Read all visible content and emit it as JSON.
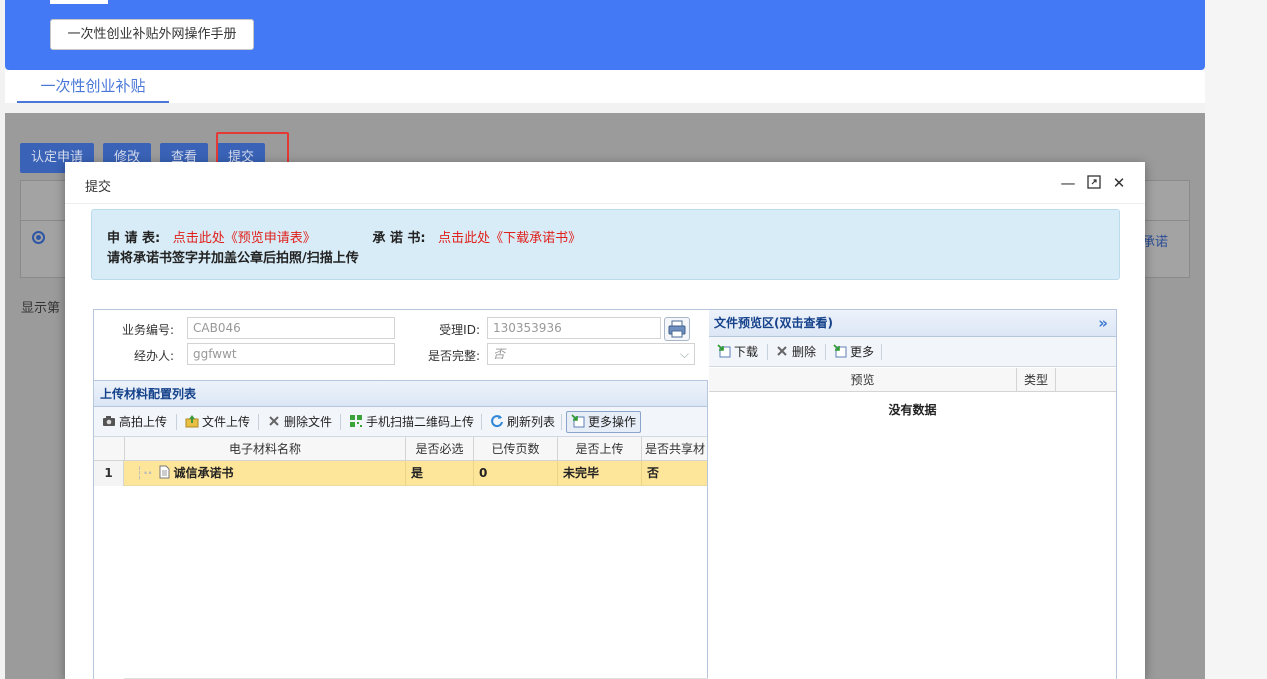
{
  "banner": {
    "manual_button": "一次性创业补贴外网操作手册"
  },
  "tabs": {
    "active": "一次性创业补贴"
  },
  "background": {
    "buttons": [
      "认定申请",
      "修改",
      "查看",
      "提交"
    ],
    "row_text_right": "承诺",
    "footer_text_left": "显示第"
  },
  "dialog": {
    "title": "提交",
    "controls": {
      "minimize": "—",
      "maximize": "⤢",
      "close": "✕"
    },
    "notice": {
      "application_label": "申 请 表:",
      "application_link": "点击此处《预览申请表》",
      "commitment_label": "承 诺 书:",
      "commitment_link": "点击此处《下载承诺书》",
      "instruction": "请将承诺书签字并加盖公章后拍照/扫描上传"
    },
    "form": {
      "business_no_label": "业务编号:",
      "business_no_value": "CAB046",
      "accept_id_label": "受理ID:",
      "accept_id_value": "130353936",
      "handler_label": "经办人:",
      "handler_value": "ggfwwt",
      "complete_label": "是否完整:",
      "complete_value": "否"
    },
    "upload_panel": {
      "title": "上传材料配置列表",
      "toolbar": [
        "高拍上传",
        "文件上传",
        "删除文件",
        "手机扫描二维码上传",
        "刷新列表",
        "更多操作"
      ],
      "columns": [
        "电子材料名称",
        "是否必选",
        "已传页数",
        "是否上传",
        "是否共享材"
      ],
      "rows": [
        {
          "index": "1",
          "name": "诚信承诺书",
          "required": "是",
          "pages": "0",
          "uploaded": "未完毕",
          "shared": "否"
        }
      ]
    },
    "preview_panel": {
      "title": "文件预览区(双击查看)",
      "expand": "»",
      "toolbar": [
        "下载",
        "删除",
        "更多"
      ],
      "columns": [
        "预览",
        "类型"
      ],
      "empty_text": "没有数据"
    }
  }
}
